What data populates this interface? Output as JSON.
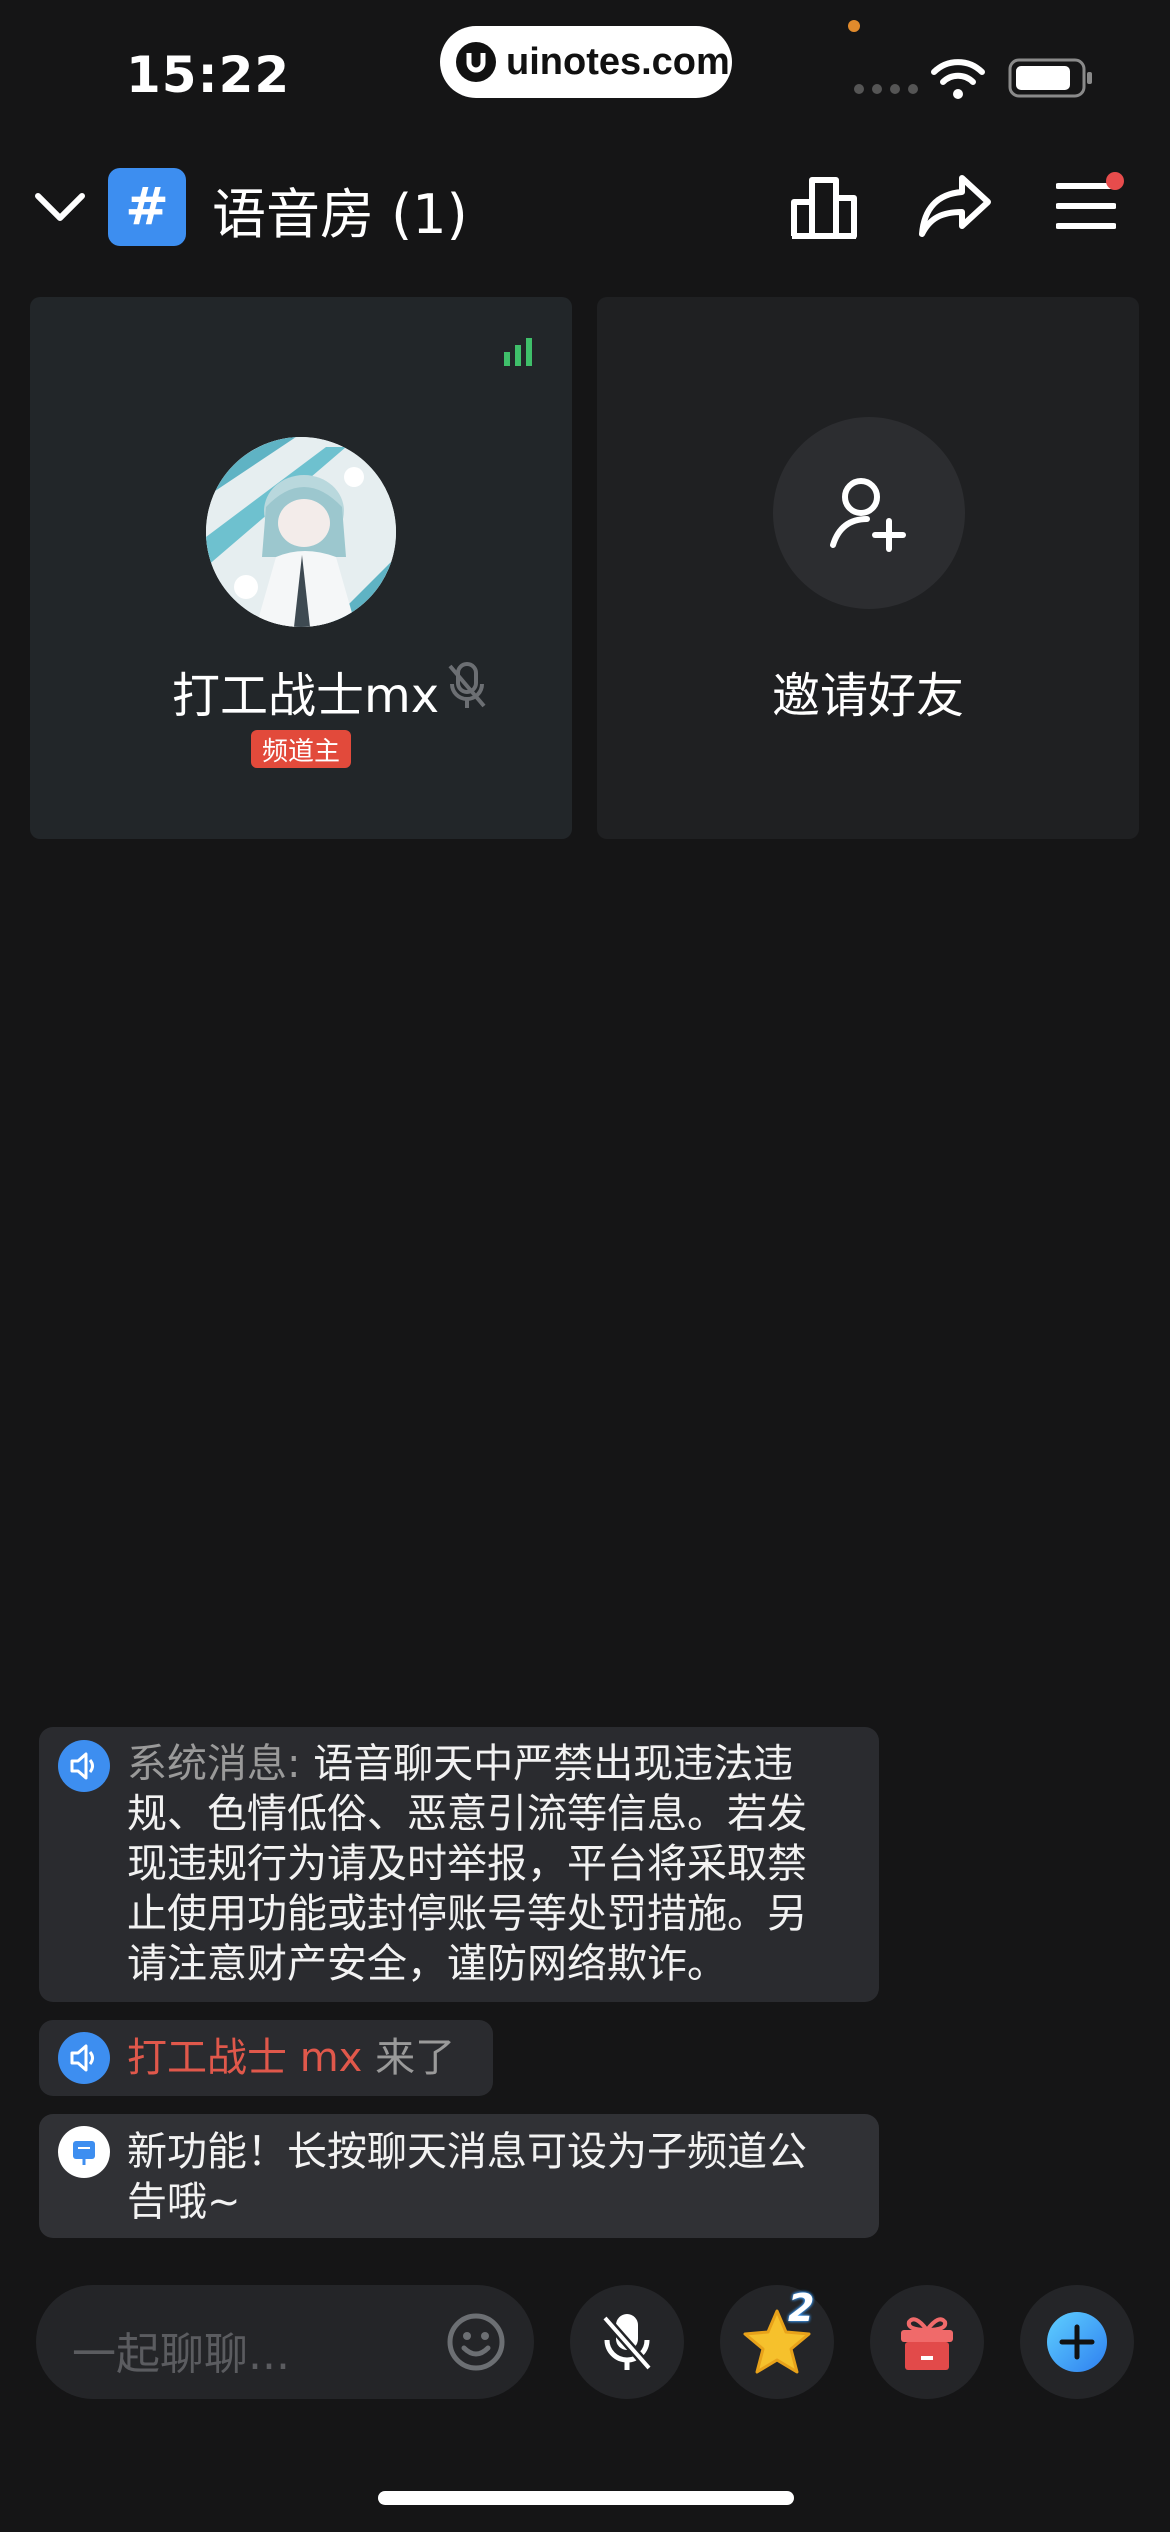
{
  "status_bar": {
    "time": "15:22",
    "site": "uinotes.com"
  },
  "header": {
    "collapse_icon": "chevron-down-icon",
    "channel_icon": "#",
    "title": "语音房 (1)",
    "actions": [
      "leaderboard-icon",
      "share-icon",
      "menu-icon"
    ],
    "menu_has_notification": true
  },
  "seats": {
    "host": {
      "name": "打工战士mx",
      "badge": "频道主",
      "mic_muted": true
    },
    "invite": {
      "label": "邀请好友"
    }
  },
  "messages": {
    "system": {
      "prefix": "系统消息:",
      "lines": [
        "语音聊天中严禁出现违法违",
        "规、色情低俗、恶意引流等信息。若发",
        "现违规行为请及时举报，平台将采取禁",
        "止使用功能或封停账号等处罚措施。另",
        "请注意财产安全，谨防网络欺诈。"
      ]
    },
    "join": {
      "user": "打工战士 mx",
      "suffix": "来了"
    },
    "tip": {
      "lines": [
        "新功能！长按聊天消息可设为子频道公",
        "告哦~"
      ]
    }
  },
  "input_bar": {
    "placeholder": "一起聊聊...",
    "star_count": "2"
  },
  "colors": {
    "accent_blue": "#3d8ef0",
    "red": "#e24a3b",
    "signal_green": "#3fbf6a"
  }
}
